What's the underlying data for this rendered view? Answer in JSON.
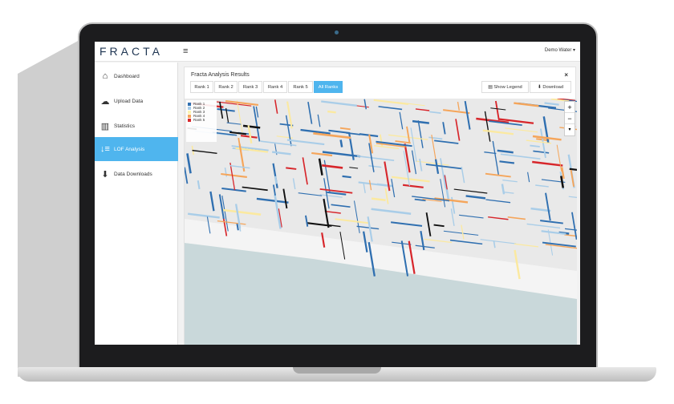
{
  "header": {
    "logo": "FRACTA",
    "menu_icon": "≡",
    "user": "Demo Water ▾"
  },
  "sidebar": {
    "items": [
      {
        "label": "Dashboard",
        "icon": "⌂"
      },
      {
        "label": "Upload Data",
        "icon": "☁"
      },
      {
        "label": "Statistics",
        "icon": "▥"
      },
      {
        "label": "LOF Analysis",
        "icon": "↓≡"
      },
      {
        "label": "Data Downloads",
        "icon": "⬇"
      }
    ]
  },
  "panel": {
    "title": "Fracta Analysis Results",
    "close": "×",
    "tabs": [
      "Rank 1",
      "Rank 2",
      "Rank 3",
      "Rank 4",
      "Rank 5",
      "All Ranks"
    ],
    "active_tab": "All Ranks",
    "show_legend": "▤ Show Legend",
    "download": "⬇ Download"
  },
  "legend": [
    {
      "label": "Rank 1",
      "color": "#2f6fb0"
    },
    {
      "label": "Rank 2",
      "color": "#a9cde8"
    },
    {
      "label": "Rank 3",
      "color": "#fbf3b0"
    },
    {
      "label": "Rank 4",
      "color": "#f5a55a"
    },
    {
      "label": "Rank 5",
      "color": "#d7262b"
    }
  ],
  "zoom": {
    "in": "+",
    "out": "−",
    "reset": "▾"
  }
}
